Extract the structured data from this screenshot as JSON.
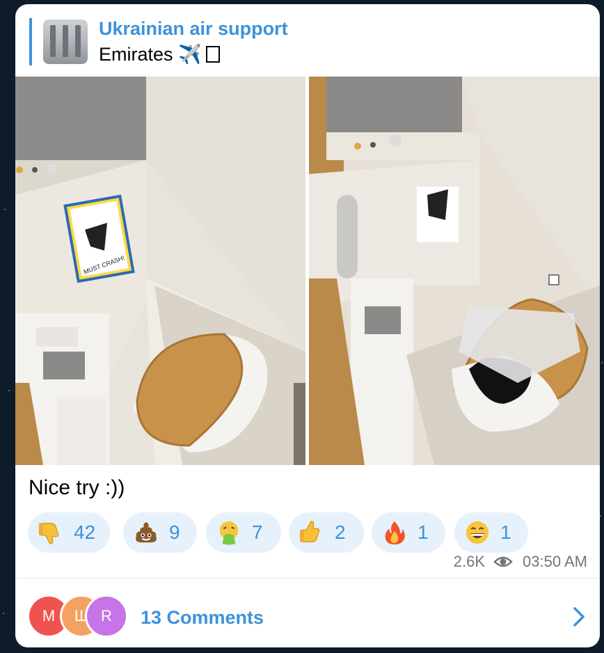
{
  "post": {
    "reply": {
      "channel": "Ukrainian air support",
      "text": "Emirates ✈️"
    },
    "caption": "Nice try :))",
    "reactions": [
      {
        "emoji": "thumbs-down",
        "count": "42"
      },
      {
        "emoji": "pile-of-poo",
        "count": "9"
      },
      {
        "emoji": "vomiting-face",
        "count": "7"
      },
      {
        "emoji": "thumbs-up",
        "count": "2"
      },
      {
        "emoji": "fire",
        "count": "1"
      },
      {
        "emoji": "grinning-face",
        "count": "1"
      }
    ],
    "views": "2.6K",
    "time": "03:50 AM",
    "comments": {
      "avatars": [
        {
          "letter": "М",
          "color": "#ef5350"
        },
        {
          "letter": "Ш",
          "color": "#f4a261"
        },
        {
          "letter": "R",
          "color": "#c774e8"
        }
      ],
      "label": "13 Comments"
    }
  },
  "colors": {
    "accent": "#3d92d9",
    "reaction_bg": "#e6f1fb",
    "meta": "#707579"
  }
}
